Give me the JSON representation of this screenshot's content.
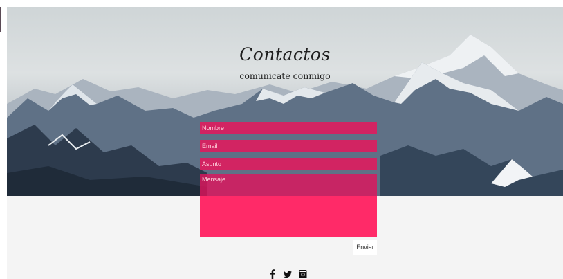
{
  "hero": {
    "title": "Contactos",
    "subtitle": "comunicate conmigo"
  },
  "form": {
    "nombre_placeholder": "Nombre",
    "email_placeholder": "Email",
    "asunto_placeholder": "Asunto",
    "mensaje_placeholder": "Mensaje",
    "send_label": "Enviar"
  },
  "social": {
    "facebook_glyph": "f",
    "twitter_glyph": "🐦",
    "instagram_glyph": "▣"
  },
  "colors": {
    "field_fill": "#eb145a",
    "message_bottom": "#ff2a68",
    "footer_bg": "#f4f4f4"
  },
  "icons": [
    "facebook-icon",
    "twitter-icon",
    "instagram-icon"
  ]
}
